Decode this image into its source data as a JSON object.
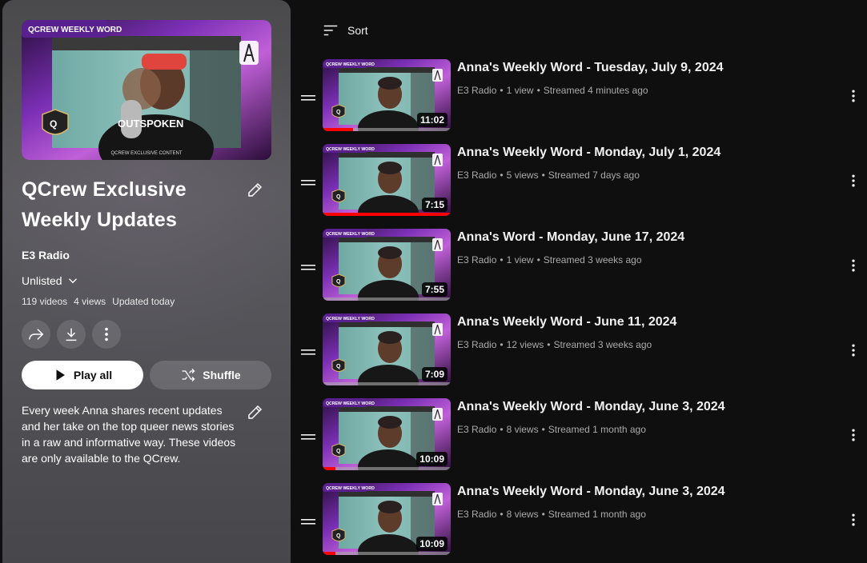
{
  "playlist": {
    "hero_banner": "QCREW WEEKLY WORD",
    "hero_footer": "QCREW EXCLUSIVE CONTENT",
    "hero_mic_text": "OUTSPOKEN",
    "title": "QCrew Exclusive Weekly Updates",
    "owner": "E3 Radio",
    "privacy": "Unlisted",
    "video_count": "119 videos",
    "views": "4 views",
    "updated": "Updated today",
    "play_all_label": "Play all",
    "shuffle_label": "Shuffle",
    "description": "Every week Anna shares recent updates and her take on the top queer news stories in a raw and informative way. These videos are only available to the QCrew."
  },
  "sort_label": "Sort",
  "thumb_banner": "QCREW WEEKLY WORD",
  "colors": {
    "accent_purple": "#8b3fd1",
    "progress_red": "#ff0000",
    "page_bg": "#0f0f0f"
  },
  "videos": [
    {
      "title": "Anna's Weekly Word - Tuesday, July 9, 2024",
      "channel": "E3 Radio",
      "views": "1 view",
      "streamed": "Streamed 4 minutes ago",
      "duration": "11:02",
      "progress": 0.24
    },
    {
      "title": "Anna's Weekly Word - Monday, July 1, 2024",
      "channel": "E3 Radio",
      "views": "5 views",
      "streamed": "Streamed 7 days ago",
      "duration": "7:15",
      "progress": 1.0
    },
    {
      "title": "Anna's Word - Monday, June 17, 2024",
      "channel": "E3 Radio",
      "views": "1 view",
      "streamed": "Streamed 3 weeks ago",
      "duration": "7:55",
      "progress": 0
    },
    {
      "title": "Anna's Weekly Word - June 11, 2024",
      "channel": "E3 Radio",
      "views": "12 views",
      "streamed": "Streamed 3 weeks ago",
      "duration": "7:09",
      "progress": 0
    },
    {
      "title": "Anna's Weekly Word - Monday, June 3, 2024",
      "channel": "E3 Radio",
      "views": "8 views",
      "streamed": "Streamed 1 month ago",
      "duration": "10:09",
      "progress": 0.1
    },
    {
      "title": "Anna's Weekly Word - Monday, June 3, 2024",
      "channel": "E3 Radio",
      "views": "8 views",
      "streamed": "Streamed 1 month ago",
      "duration": "10:09",
      "progress": 0.1
    }
  ]
}
